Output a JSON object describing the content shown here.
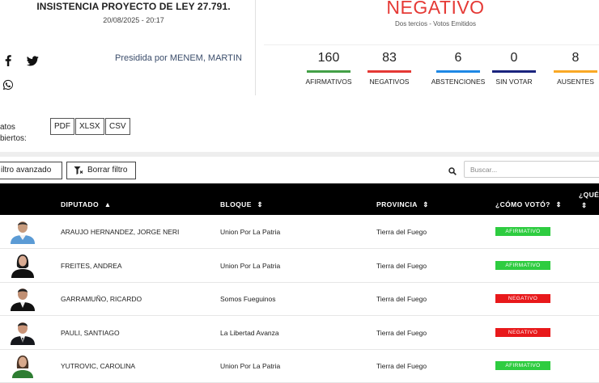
{
  "header": {
    "title": "INSISTENCIA PROYECTO DE LEY 27.791.",
    "datetime": "20/08/2025 - 20:17",
    "presided_by": "Presidida por MENEM, MARTIN",
    "share_icons": [
      "facebook-icon",
      "twitter-icon",
      "whatsapp-icon"
    ]
  },
  "result": {
    "label": "NEGATIVO",
    "subtitle": "Dos tercios - Votos Emitidos",
    "color": "#e53935"
  },
  "stats": [
    {
      "value": "160",
      "label": "AFIRMATIVOS",
      "color": "#43a047"
    },
    {
      "value": "83",
      "label": "NEGATIVOS",
      "color": "#e53935"
    },
    {
      "value": "6",
      "label": "ABSTENCIONES",
      "color": "#1e88e5"
    },
    {
      "value": "0",
      "label": "SIN VOTAR",
      "color": "#1a237e"
    },
    {
      "value": "8",
      "label": "AUSENTES",
      "color": "#f9a825"
    }
  ],
  "formats": {
    "label_line1": "atos",
    "label_line2": "biertos:",
    "buttons": [
      "PDF",
      "XLSX",
      "CSV"
    ]
  },
  "toolbar": {
    "advanced_filter": "iltro avanzado",
    "clear_filter": "Borrar filtro",
    "search_placeholder": "Buscar..."
  },
  "table": {
    "columns": [
      "DIPUTADO",
      "BLOQUE",
      "PROVINCIA",
      "¿CÓMO VOTÓ?",
      "¿QUÉ"
    ],
    "rows": [
      {
        "name": "ARAUJO HERNANDEZ, JORGE NERI",
        "bloque": "Union Por La Patria",
        "provincia": "Tierra del Fuego",
        "voto": "AFIRMATIVO",
        "voto_color": "#2ecc40"
      },
      {
        "name": "FREITES, ANDREA",
        "bloque": "Union Por La Patria",
        "provincia": "Tierra del Fuego",
        "voto": "AFIRMATIVO",
        "voto_color": "#2ecc40"
      },
      {
        "name": "GARRAMUÑO, RICARDO",
        "bloque": "Somos Fueguinos",
        "provincia": "Tierra del Fuego",
        "voto": "NEGATIVO",
        "voto_color": "#e8191b"
      },
      {
        "name": "PAULI, SANTIAGO",
        "bloque": "La Libertad Avanza",
        "provincia": "Tierra del Fuego",
        "voto": "NEGATIVO",
        "voto_color": "#e8191b"
      },
      {
        "name": "YUTROVIC, CAROLINA",
        "bloque": "Union Por La Patria",
        "provincia": "Tierra del Fuego",
        "voto": "AFIRMATIVO",
        "voto_color": "#2ecc40"
      }
    ]
  }
}
